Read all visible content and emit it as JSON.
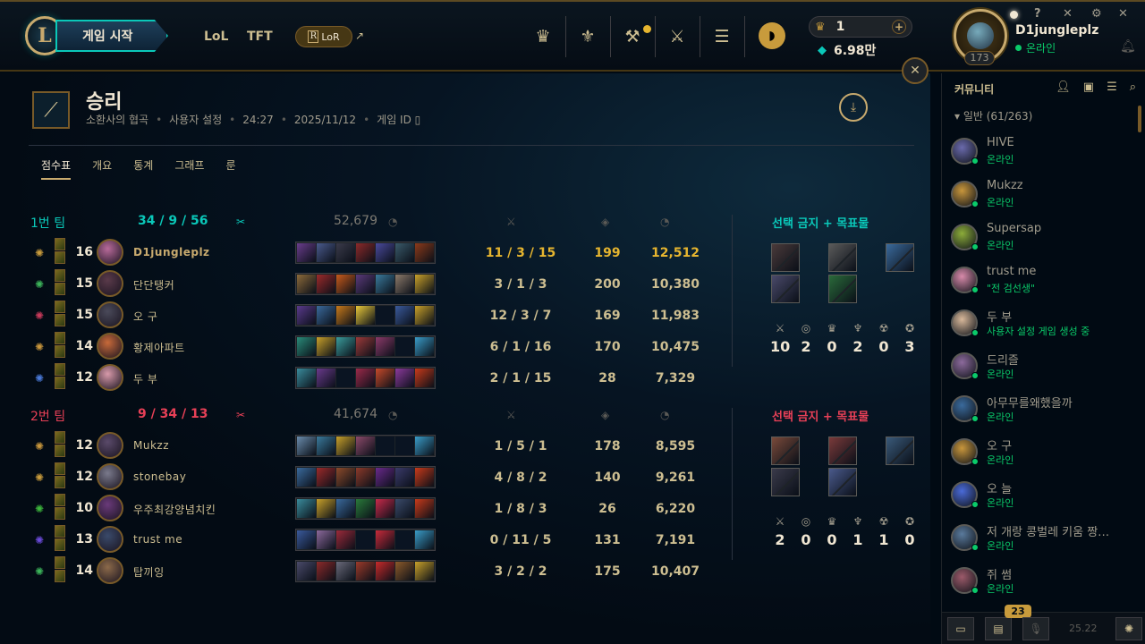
{
  "header": {
    "play_button": "게임 시작",
    "nav": [
      "LoL",
      "TFT"
    ],
    "lor_label": "LoR",
    "lor_mark": "R",
    "blue_essence_count": "1",
    "rp_amount": "6.98만",
    "profile": {
      "name": "D1jungleplz",
      "status": "온라인",
      "level": "173"
    },
    "window_controls": [
      "?",
      "✕",
      "⚙",
      "✕"
    ]
  },
  "match": {
    "result": "승리",
    "map": "소환사의 협곡",
    "mode": "사용자 설정",
    "duration": "24:27",
    "date": "2025/11/12",
    "game_id_label": "게임 ID",
    "tabs": [
      "점수표",
      "개요",
      "통계",
      "그래프",
      "룬"
    ],
    "active_tab": 0
  },
  "teams": [
    {
      "name": "1번 팀",
      "kda": "34 / 9 / 56",
      "gold": "52,679",
      "color": "#0ac8b9",
      "bans_title": "선택 금지 + 목표물",
      "objectives": [
        "10",
        "2",
        "0",
        "2",
        "0",
        "3"
      ],
      "players": [
        {
          "level": "16",
          "name": "D1jungleplz",
          "kda": "11 / 3 / 15",
          "cs": "199",
          "gold": "12,512",
          "me": true,
          "rune_color": "#c89b3c",
          "champ_color": "#b86a9a",
          "items": [
            "#6a3d8c",
            "#4a5a8c",
            "#3a3a4a",
            "#8c2a2a",
            "#4a4a9c",
            "#3a5a6a",
            "#8c3a1a"
          ]
        },
        {
          "level": "15",
          "name": "단단탱커",
          "kda": "3 / 1 / 3",
          "cs": "200",
          "gold": "10,380",
          "me": false,
          "rune_color": "#3cb45a",
          "champ_color": "#5a3a4a",
          "items": [
            "#8c6a3a",
            "#9c2a2a",
            "#c85a1a",
            "#5a3a7a",
            "#3a7a9c",
            "#8c7a6a",
            "#c8a02a"
          ]
        },
        {
          "level": "15",
          "name": "오 구",
          "kda": "12 / 3 / 7",
          "cs": "169",
          "gold": "11,983",
          "me": false,
          "rune_color": "#c83a5a",
          "champ_color": "#4a4a5a",
          "items": [
            "#5a3a8c",
            "#3a6a9c",
            "#c87a1a",
            "#e8c83a",
            "#0a1422",
            "#3a5a9c",
            "#c8a02a"
          ]
        },
        {
          "level": "14",
          "name": "황제아파트",
          "kda": "6 / 1 / 16",
          "cs": "170",
          "gold": "10,475",
          "me": false,
          "rune_color": "#c8963c",
          "champ_color": "#c86a3a",
          "items": [
            "#2a8c7a",
            "#c8a02a",
            "#3a9c9c",
            "#9c3a3a",
            "#8c3a6a",
            "#0a1422",
            "#3a9cc8"
          ]
        },
        {
          "level": "12",
          "name": "두 부",
          "kda": "2 / 1 / 15",
          "cs": "28",
          "gold": "7,329",
          "me": false,
          "rune_color": "#4a7ad8",
          "champ_color": "#d89aaa",
          "items": [
            "#3a8c9c",
            "#6a3a8c",
            "#0a1422",
            "#9c2a4a",
            "#c84a2a",
            "#8c3a9c",
            "#c83a1a"
          ]
        }
      ]
    },
    {
      "name": "2번 팀",
      "kda": "9 / 34 / 13",
      "gold": "41,674",
      "color": "#e84057",
      "bans_title": "선택 금지 + 목표물",
      "objectives": [
        "2",
        "0",
        "0",
        "1",
        "1",
        "0"
      ],
      "players": [
        {
          "level": "12",
          "name": "Mukzz",
          "kda": "1 / 5 / 1",
          "cs": "178",
          "gold": "8,595",
          "me": false,
          "rune_color": "#c8963c",
          "champ_color": "#5a4a6a",
          "items": [
            "#6a8cac",
            "#3a7a9c",
            "#c8a02a",
            "#8c4a6a",
            "#0a1422",
            "#0a1422",
            "#3a9cc8"
          ]
        },
        {
          "level": "12",
          "name": "stonebay",
          "kda": "4 / 8 / 2",
          "cs": "140",
          "gold": "9,261",
          "me": false,
          "rune_color": "#c89b3c",
          "champ_color": "#7a7a8c",
          "items": [
            "#3a6a9c",
            "#9c2a2a",
            "#8c4a2a",
            "#8c3a2a",
            "#6a2a8c",
            "#3a3a6a",
            "#c83a1a"
          ]
        },
        {
          "level": "10",
          "name": "우주최강양념치킨",
          "kda": "1 / 8 / 3",
          "cs": "26",
          "gold": "6,220",
          "me": false,
          "rune_color": "#3cb43c",
          "champ_color": "#6a3a7a",
          "items": [
            "#3a8c9c",
            "#c8a02a",
            "#3a6a9c",
            "#2a7a3a",
            "#c82a4a",
            "#3a4a6a",
            "#c83a1a"
          ]
        },
        {
          "level": "13",
          "name": "trust me",
          "kda": "0 / 11 / 5",
          "cs": "131",
          "gold": "7,191",
          "me": false,
          "rune_color": "#6a4ad8",
          "champ_color": "#3a4a6a",
          "items": [
            "#3a5a9c",
            "#8c6a9c",
            "#9c2a3a",
            "#0a1422",
            "#c82a3a",
            "#0a1422",
            "#3a9cc8"
          ]
        },
        {
          "level": "14",
          "name": "탑끼잉",
          "kda": "3 / 2 / 2",
          "cs": "175",
          "gold": "10,407",
          "me": false,
          "rune_color": "#3cb45a",
          "champ_color": "#8c6a4a",
          "items": [
            "#4a4a6a",
            "#8c2a2a",
            "#6a6a7a",
            "#9c3a2a",
            "#c82a2a",
            "#8c5a2a",
            "#c8a02a"
          ]
        }
      ]
    }
  ],
  "social": {
    "title": "커뮤니티",
    "group": "일반 (61/263)",
    "friends": [
      {
        "name": "HIVE",
        "status": "온라인",
        "color": "#6a6aac"
      },
      {
        "name": "Mukzz",
        "status": "온라인",
        "color": "#c8963c"
      },
      {
        "name": "Supersap",
        "status": "온라인",
        "color": "#8cac3a"
      },
      {
        "name": "trust me",
        "status": "\"전 검선생\"",
        "color": "#d88aaa"
      },
      {
        "name": "두 부",
        "status": "사용자 설정 게임 생성 중",
        "color": "#d8b89a"
      },
      {
        "name": "드리즐",
        "status": "온라인",
        "color": "#8c6a9c"
      },
      {
        "name": "아무무를왜했을까",
        "status": "온라인",
        "color": "#3a6a9c"
      },
      {
        "name": "오 구",
        "status": "온라인",
        "color": "#c8963c"
      },
      {
        "name": "오 늘",
        "status": "온라인",
        "color": "#4a6ad8"
      },
      {
        "name": "저 개랑 콩벌레 키움 짱…",
        "status": "온라인",
        "color": "#5a7a9c"
      },
      {
        "name": "쥐 썸",
        "status": "온라인",
        "color": "#9c5a6a"
      }
    ],
    "notification_count": "23",
    "version": "25.22"
  }
}
